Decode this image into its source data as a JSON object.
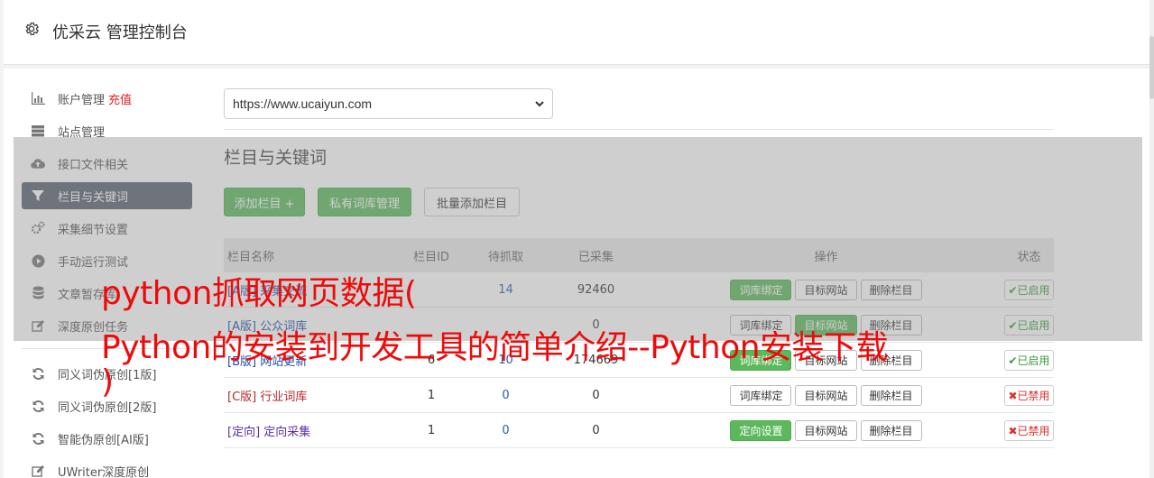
{
  "header": {
    "title": "优采云 管理控制台"
  },
  "sidebar": {
    "items": [
      {
        "label": "账户管理",
        "extra": "充值",
        "icon": "bar-chart-icon"
      },
      {
        "label": "站点管理",
        "icon": "server-icon"
      },
      {
        "label": "接口文件相关",
        "icon": "cloud-upload-icon"
      },
      {
        "label": "栏目与关键词",
        "icon": "filter-icon",
        "active": true
      },
      {
        "label": "采集细节设置",
        "icon": "gears-icon"
      },
      {
        "label": "手动运行测试",
        "icon": "play-icon"
      },
      {
        "label": "文章暂存库",
        "icon": "database-icon"
      },
      {
        "label": "深度原创任务",
        "icon": "edit-icon"
      }
    ],
    "items2": [
      {
        "label": "同义词伪原创[1版]",
        "icon": "refresh-icon"
      },
      {
        "label": "同义词伪原创[2版]",
        "icon": "refresh-icon"
      },
      {
        "label": "智能伪原创[AI版]",
        "icon": "refresh-icon"
      },
      {
        "label": "UWriter深度原创",
        "icon": "edit-icon"
      }
    ]
  },
  "main": {
    "site_select": {
      "value": "https://www.ucaiyun.com"
    },
    "section_title": "栏目与关键词",
    "buttons": {
      "add_column": "添加栏目 +",
      "private_lib": "私有词库管理",
      "batch_add": "批量添加栏目"
    },
    "table": {
      "headers": [
        "栏目名称",
        "栏目ID",
        "待抓取",
        "已采集",
        "操作",
        "状态"
      ],
      "ops": {
        "bind_lib": "词库绑定",
        "target_site": "目标网站",
        "delete": "删除栏目",
        "directed": "定向设置"
      },
      "status": {
        "enabled": "✔已启用",
        "disabled": "✖已禁用"
      },
      "rows": [
        {
          "tag": "[A版]",
          "name": "采集交流",
          "id": "",
          "pending": "14",
          "done": "92460"
        },
        {
          "tag": "[A版]",
          "name": "公众词库",
          "id": "",
          "pending": "",
          "done": "0"
        },
        {
          "tag": "[B版]",
          "name": "网站更新",
          "id": "6",
          "pending": "10",
          "done": "174669"
        },
        {
          "tag": "[C版]",
          "name": "行业词库",
          "id": "1",
          "pending": "0",
          "done": "0"
        },
        {
          "tag": "[定向]",
          "name": "定向采集",
          "id": "1",
          "pending": "0",
          "done": "0"
        }
      ]
    }
  },
  "banner": {
    "line1": "python抓取网页数据(",
    "line2": "Python的安装到开发工具的简单介绍--Python安装下载",
    "line3": ")"
  },
  "colors": {
    "accent_green": "#5cb85c",
    "banner_red": "#ee0a0a",
    "active_nav": "#5a6170"
  }
}
